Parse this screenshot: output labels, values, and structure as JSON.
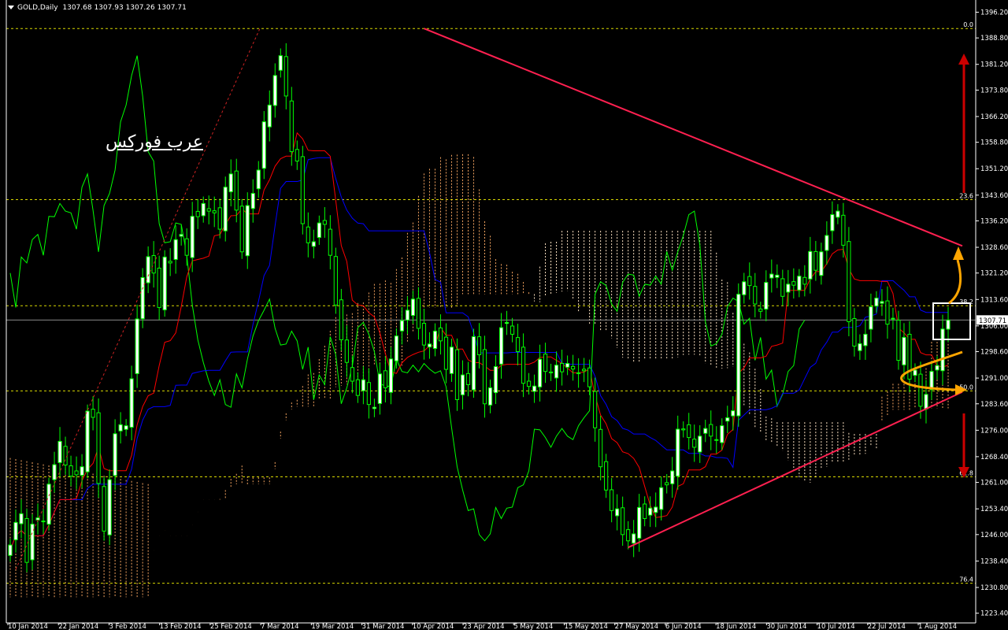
{
  "header": {
    "symbol_label": "GOLD,Daily",
    "ohlc": "1307.68 1307.93 1307.26 1307.71"
  },
  "watermark": "عرب فوركس",
  "colors": {
    "background": "#000000",
    "bull_candle": "#ffffff",
    "bear_candle": "#000000",
    "candle_wick": "#00ff00",
    "tenkan": "#ff0000",
    "kijun": "#0000ff",
    "chikou": "#00ff00",
    "trendline": "#ff2050",
    "fib_line": "#ffff00",
    "cloud_a": "#f4a460",
    "cloud_b": "#ffe4c4",
    "arrow_red": "#cc0000",
    "arrow_orange": "#ffa500"
  },
  "chart_data": {
    "type": "candlestick",
    "title": "GOLD,Daily",
    "ylim": [
      1220.6,
      1398.8
    ],
    "y_ticks": [
      "1396.20",
      "1388.80",
      "1381.20",
      "1373.80",
      "1366.20",
      "1358.80",
      "1351.20",
      "1343.60",
      "1336.20",
      "1328.60",
      "1321.20",
      "1313.60",
      "1306.00",
      "1298.60",
      "1291.00",
      "1283.60",
      "1276.00",
      "1268.40",
      "1261.00",
      "1253.40",
      "1246.00",
      "1238.40",
      "1230.80",
      "1223.40"
    ],
    "x_ticks": [
      "10 Jan 2014",
      "22 Jan 2014",
      "3 Feb 2014",
      "13 Feb 2014",
      "25 Feb 2014",
      "7 Mar 2014",
      "19 Mar 2014",
      "31 Mar 2014",
      "10 Apr 2014",
      "23 Apr 2014",
      "5 May 2014",
      "15 May 2014",
      "27 May 2014",
      "6 Jun 2014",
      "18 Jun 2014",
      "30 Jun 2014",
      "10 Jul 2014",
      "22 Jul 2014",
      "1 Aug 2014"
    ],
    "current_price": "1307.71",
    "fib_levels": [
      {
        "label": "0.0",
        "value": 1391.5
      },
      {
        "label": "23.6",
        "value": 1342.3
      },
      {
        "label": "38.2",
        "value": 1311.8
      },
      {
        "label": "50.0",
        "value": 1287.3
      },
      {
        "label": "61.8",
        "value": 1262.6
      },
      {
        "label": "76.4",
        "value": 1232.0
      }
    ],
    "trendlines": [
      {
        "from": [
          75,
          1391.5
        ],
        "to": [
          164,
          1329.0
        ]
      },
      {
        "from": [
          112,
          1242.3
        ],
        "to": [
          164,
          1287.0
        ]
      }
    ],
    "series": [
      {
        "name": "close",
        "values": [
          1243.0,
          1249.5,
          1252.0,
          1238.0,
          1249.0,
          1250.8,
          1249.9,
          1260.5,
          1266.1,
          1272.8,
          1266.0,
          1262.8,
          1263.2,
          1265.5,
          1281.5,
          1279.7,
          1260.7,
          1247.0,
          1261.8,
          1275.0,
          1277.6,
          1277.3,
          1290.8,
          1308.0,
          1319.9,
          1325.9,
          1321.2,
          1311.3,
          1325.8,
          1324.1,
          1330.8,
          1332.3,
          1326.3,
          1337.5,
          1337.4,
          1341.2,
          1339.0,
          1338.5,
          1333.8,
          1345.9,
          1349.7,
          1339.3,
          1327.3,
          1340.6,
          1344.1,
          1350.8,
          1364.7,
          1369.5,
          1378.0,
          1383.7,
          1372.1,
          1356.1,
          1353.4,
          1335.4,
          1329.9,
          1330.2,
          1335.6,
          1335.2,
          1326.3,
          1312.0,
          1302.0,
          1295.5,
          1290.1,
          1286.0,
          1290.5,
          1283.4,
          1282.6,
          1292.2,
          1288.2,
          1296.5,
          1303.1,
          1307.5,
          1310.5,
          1313.7,
          1305.3,
          1300.5,
          1300.8,
          1304.5,
          1301.7,
          1293.5,
          1299.9,
          1284.8,
          1291.9,
          1289.1,
          1302.9,
          1297.7,
          1283.6,
          1288.2,
          1294.3,
          1305.5,
          1307.0,
          1303.6,
          1298.6,
          1289.5,
          1288.6,
          1288.7,
          1296.4,
          1292.9,
          1292.5,
          1294.7,
          1292.8,
          1295.2,
          1293.6,
          1292.4,
          1293.1,
          1288.5,
          1276.7,
          1265.5,
          1258.8,
          1252.9,
          1253.4,
          1246.0,
          1244.2,
          1246.2,
          1253.8,
          1250.6,
          1253.6,
          1253.9,
          1259.5,
          1260.3,
          1264.3,
          1276.3,
          1276.1,
          1273.9,
          1271.1,
          1274.3,
          1276.5,
          1274.3,
          1273.3,
          1277.3,
          1279.6,
          1281.6,
          1315.1,
          1318.7,
          1317.6,
          1312.3,
          1310.2,
          1318.5,
          1320.9,
          1320.6,
          1314.5,
          1318.0,
          1317.7,
          1320.3,
          1318.0,
          1327.4,
          1322.0,
          1327.3,
          1332.0,
          1338.0,
          1339.0,
          1329.2,
          1307.2,
          1300.2,
          1300.9,
          1303.6,
          1311.5,
          1314.0,
          1313.0,
          1306.5,
          1308.2,
          1296.1,
          1302.7,
          1290.7,
          1293.3,
          1282.9,
          1286.3,
          1292.9,
          1294.6,
          1305.1,
          1307.7
        ]
      }
    ],
    "annotations": [
      "50.0"
    ]
  }
}
